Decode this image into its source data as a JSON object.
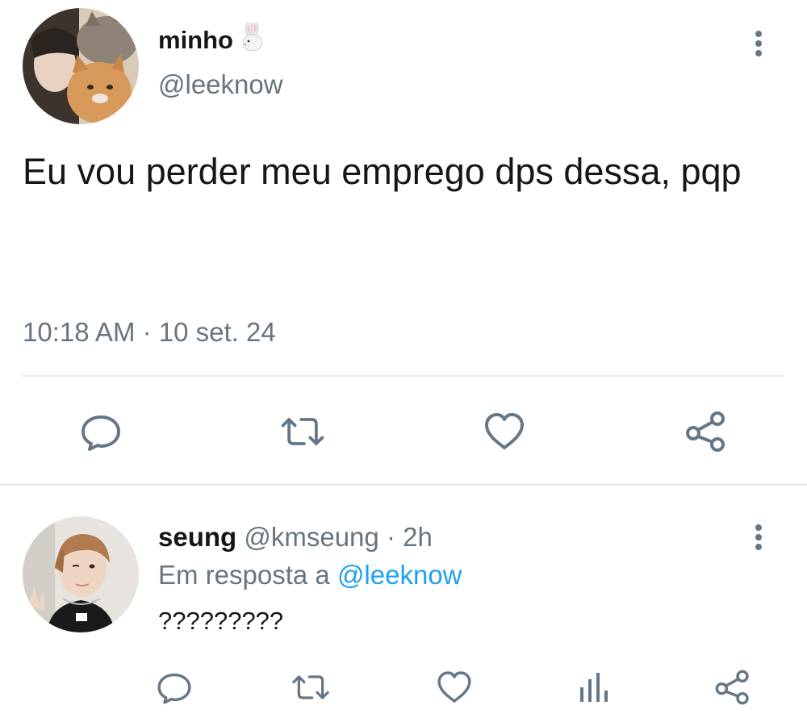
{
  "tweet": {
    "author_name": "minho",
    "author_handle": "@leeknow",
    "text": "Eu vou perder meu emprego dps dessa, pqp",
    "timestamp": "10:18 AM · 10 set. 24",
    "icons": {
      "name_emoji": "rabbit-icon",
      "more": "more-vertical-icon",
      "reply": "reply-icon",
      "retweet": "retweet-icon",
      "like": "heart-icon",
      "share": "share-icon"
    }
  },
  "reply": {
    "author_name": "seung",
    "author_handle": "@kmseung",
    "separator": "·",
    "age": "2h",
    "in_reply_to_prefix": "Em resposta a",
    "in_reply_to_handle": "@leeknow",
    "text": "?????????",
    "icons": {
      "more": "more-vertical-icon",
      "reply": "reply-icon",
      "retweet": "retweet-icon",
      "like": "heart-icon",
      "analytics": "analytics-icon",
      "share": "share-icon"
    }
  },
  "colors": {
    "text_primary": "#14171a",
    "text_secondary": "#66757f",
    "icon": "#657786",
    "link": "#1da1f2",
    "divider": "#e6ecf0"
  }
}
